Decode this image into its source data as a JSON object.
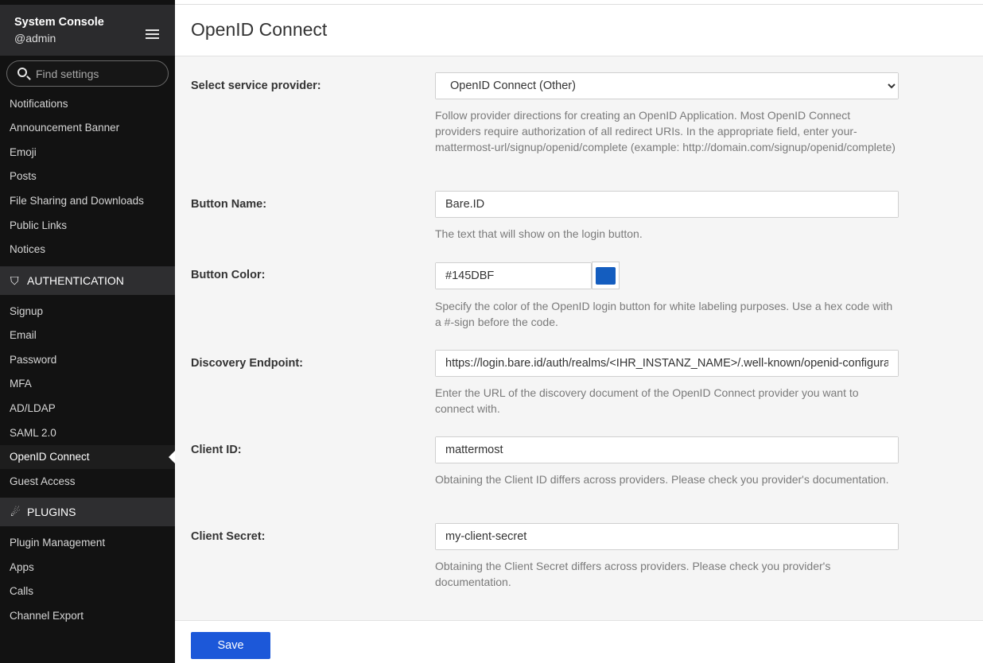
{
  "sidebar": {
    "title": "System Console",
    "user": "@admin",
    "search_placeholder": "Find settings",
    "items_top": [
      "Notifications",
      "Announcement Banner",
      "Emoji",
      "Posts",
      "File Sharing and Downloads",
      "Public Links",
      "Notices"
    ],
    "section_auth": "AUTHENTICATION",
    "items_auth": [
      "Signup",
      "Email",
      "Password",
      "MFA",
      "AD/LDAP",
      "SAML 2.0",
      "OpenID Connect",
      "Guest Access"
    ],
    "active_item": "OpenID Connect",
    "section_plugins": "PLUGINS",
    "items_plugins": [
      "Plugin Management",
      "Apps",
      "Calls",
      "Channel Export"
    ]
  },
  "page": {
    "title": "OpenID Connect"
  },
  "form": {
    "provider": {
      "label": "Select service provider:",
      "value": "OpenID Connect (Other)",
      "help": "Follow provider directions for creating an OpenID Application. Most OpenID Connect providers require authorization of all redirect URIs. In the appropriate field, enter your-mattermost-url/signup/openid/complete (example: http://domain.com/signup/openid/complete)"
    },
    "button_name": {
      "label": "Button Name:",
      "value": "Bare.ID",
      "help": "The text that will show on the login button."
    },
    "button_color": {
      "label": "Button Color:",
      "value": "#145DBF",
      "swatch_color": "#145DBF",
      "help": "Specify the color of the OpenID login button for white labeling purposes. Use a hex code with a #-sign before the code."
    },
    "discovery": {
      "label": "Discovery Endpoint:",
      "value": "https://login.bare.id/auth/realms/<IHR_INSTANZ_NAME>/.well-known/openid-configuration",
      "help": "Enter the URL of the discovery document of the OpenID Connect provider you want to connect with."
    },
    "client_id": {
      "label": "Client ID:",
      "value": "mattermost",
      "help": "Obtaining the Client ID differs across providers. Please check you provider's documentation."
    },
    "client_secret": {
      "label": "Client Secret:",
      "value": "my-client-secret",
      "help": "Obtaining the Client Secret differs across providers. Please check you provider's documentation."
    }
  },
  "footer": {
    "save_label": "Save"
  },
  "colors": {
    "sidebar_bg": "#121212",
    "accent": "#1c58d9"
  }
}
